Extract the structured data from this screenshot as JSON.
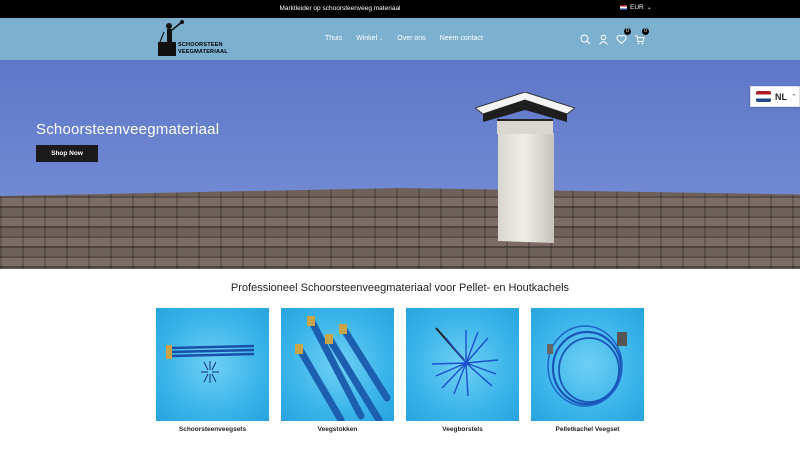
{
  "topbar": {
    "message": "Marktleider op schoorsteenveeg materiaal",
    "currency": "EUR"
  },
  "logo": {
    "line1": "SCHOORSTEEN",
    "line2": "VEEGMATERIAAL"
  },
  "nav": {
    "items": [
      "Thuis",
      "Winkel",
      "Over ons",
      "Neem contact"
    ]
  },
  "header_icons": {
    "search": "search-icon",
    "account": "user-icon",
    "wishlist": "heart-icon",
    "wishlist_count": "0",
    "cart": "cart-icon",
    "cart_count": "0"
  },
  "hero": {
    "title": "Schoorsteenveegmateriaal",
    "button": "Shop Now"
  },
  "language": {
    "code": "NL"
  },
  "collections": {
    "title": "Professioneel Schoorsteenveegmateriaal voor Pellet- en Houtkachels",
    "items": [
      {
        "label": "Schoorsteenveegsets"
      },
      {
        "label": "Veegstokken"
      },
      {
        "label": "Veegborstels"
      },
      {
        "label": "Pelletkachel Veegset"
      }
    ]
  },
  "colors": {
    "header_bg": "#7bb0cf",
    "topbar_bg": "#000000",
    "button_bg": "#1a1a1a",
    "card_bg": "#3bb4ea"
  }
}
